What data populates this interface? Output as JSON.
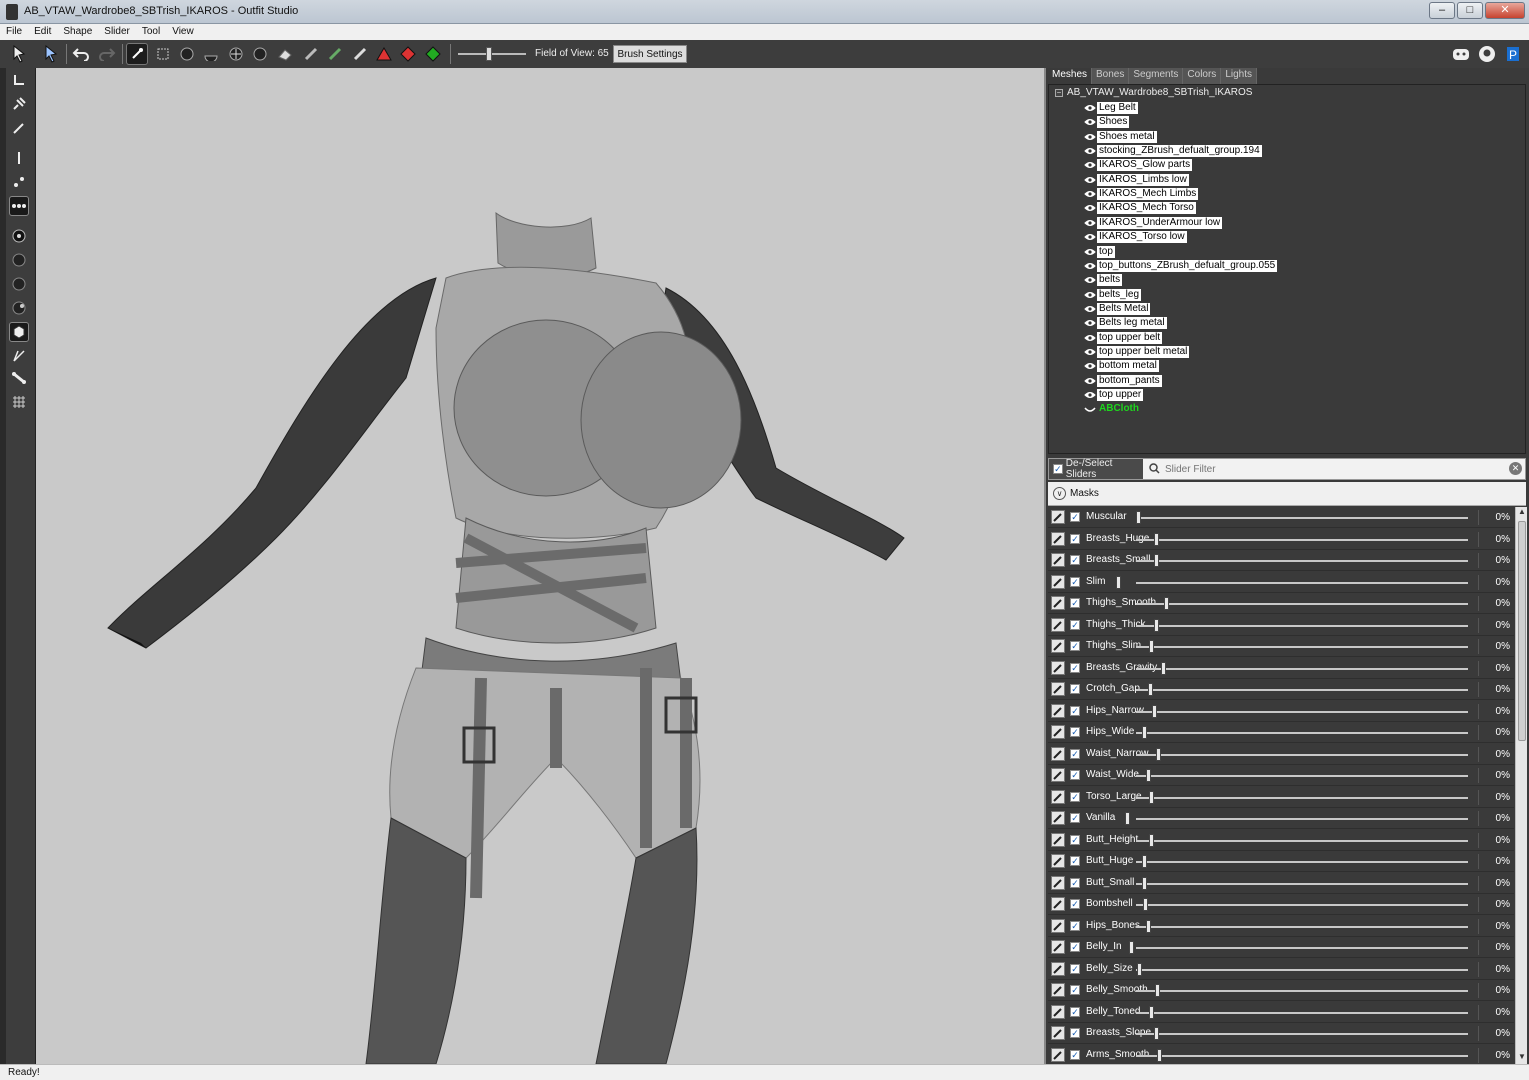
{
  "window": {
    "title": "AB_VTAW_Wardrobe8_SBTrish_IKAROS - Outfit Studio"
  },
  "menu": [
    "File",
    "Edit",
    "Shape",
    "Slider",
    "Tool",
    "View"
  ],
  "toolbar": {
    "fov_label": "Field of View: 65",
    "fov_level": 0.45,
    "brush_settings": "Brush Settings"
  },
  "tabs": [
    "Meshes",
    "Bones",
    "Segments",
    "Colors",
    "Lights"
  ],
  "mesh_tree": {
    "root": "AB_VTAW_Wardrobe8_SBTrish_IKAROS",
    "items": [
      "Leg Belt",
      "Shoes",
      "Shoes metal",
      "stocking_ZBrush_defualt_group.194",
      "IKAROS_Glow parts",
      "IKAROS_Limbs low",
      "IKAROS_Mech Limbs",
      "IKAROS_Mech Torso",
      "IKAROS_UnderArmour low",
      "IKAROS_Torso low",
      "top",
      "top_buttons_ZBrush_defualt_group.055",
      "belts",
      "belts_leg",
      "Belts Metal",
      "Belts leg metal",
      "top upper belt",
      "top upper belt metal",
      "bottom metal",
      "bottom_pants",
      "top upper"
    ],
    "special_item": "ABCloth"
  },
  "slider_panel": {
    "deselect_label": "De-/Select Sliders",
    "filter_placeholder": "Slider Filter",
    "masks_label": "Masks"
  },
  "sliders": [
    {
      "name": "Muscular",
      "value": "0%"
    },
    {
      "name": "Breasts_Huge",
      "value": "0%"
    },
    {
      "name": "Breasts_Small",
      "value": "0%"
    },
    {
      "name": "Slim",
      "value": "0%"
    },
    {
      "name": "Thighs_Smooth",
      "value": "0%"
    },
    {
      "name": "Thighs_Thick",
      "value": "0%"
    },
    {
      "name": "Thighs_Slim",
      "value": "0%"
    },
    {
      "name": "Breasts_Gravity",
      "value": "0%"
    },
    {
      "name": "Crotch_Gap",
      "value": "0%"
    },
    {
      "name": "Hips_Narrow",
      "value": "0%"
    },
    {
      "name": "Hips_Wide",
      "value": "0%"
    },
    {
      "name": "Waist_Narrow",
      "value": "0%"
    },
    {
      "name": "Waist_Wide",
      "value": "0%"
    },
    {
      "name": "Torso_Large",
      "value": "0%"
    },
    {
      "name": "Vanilla",
      "value": "0%"
    },
    {
      "name": "Butt_Height",
      "value": "0%"
    },
    {
      "name": "Butt_Huge",
      "value": "0%"
    },
    {
      "name": "Butt_Small",
      "value": "0%"
    },
    {
      "name": "Bombshell",
      "value": "0%"
    },
    {
      "name": "Hips_Bones",
      "value": "0%"
    },
    {
      "name": "Belly_In",
      "value": "0%"
    },
    {
      "name": "Belly_Size",
      "value": "0%"
    },
    {
      "name": "Belly_Smooth",
      "value": "0%"
    },
    {
      "name": "Belly_Toned",
      "value": "0%"
    },
    {
      "name": "Breasts_Slope",
      "value": "0%"
    },
    {
      "name": "Arms_Smooth",
      "value": "0%"
    }
  ],
  "status": "Ready!"
}
